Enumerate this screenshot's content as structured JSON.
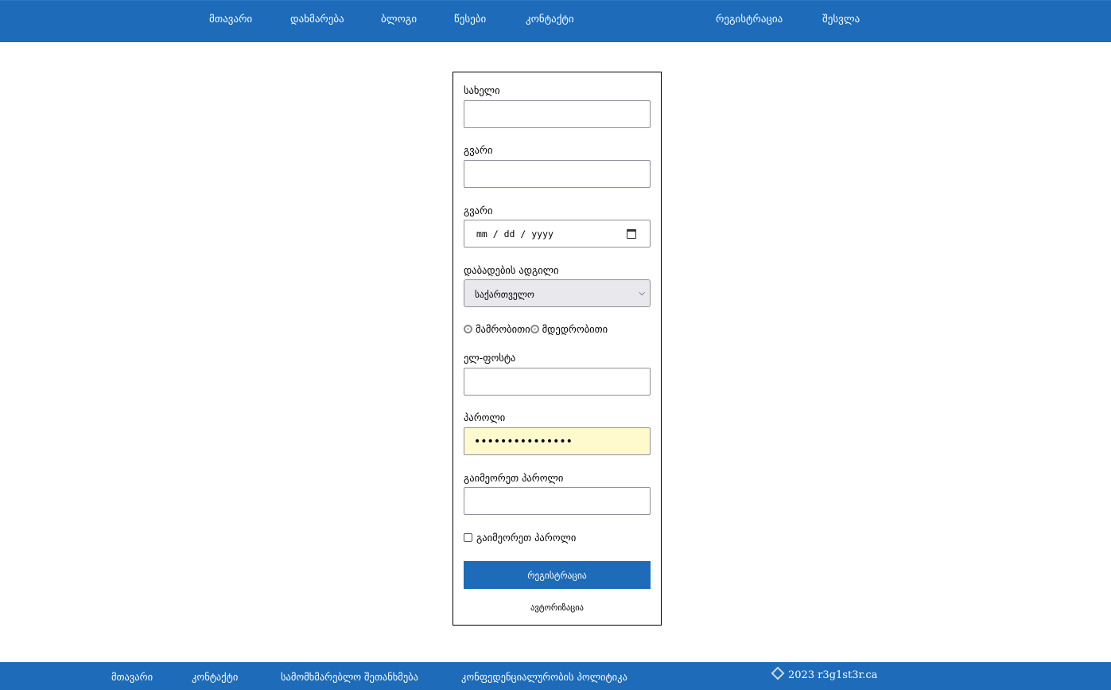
{
  "nav": {
    "left": [
      "მთავარი",
      "დახმარება",
      "ბლოგი",
      "წესები",
      "კონტაქტი"
    ],
    "right": [
      "რეგისტრაცია",
      "შესვლა"
    ]
  },
  "form": {
    "first_name_label": "სახელი",
    "first_name_value": "",
    "last_name_label": "გვარი",
    "last_name_value": "",
    "birthdate_label": "გვარი",
    "birthdate_placeholder": "mm / dd / yyyy",
    "birthplace_label": "დაბადების ადგილი",
    "birthplace_selected": "საქართველო",
    "gender_options": [
      "მამრობითი",
      "მდედრობითი"
    ],
    "email_label": "ელ-ფოსტა",
    "email_value": "",
    "password_label": "პაროლი",
    "password_value": "•••••••••••••••",
    "repeat_password_label": "გაიმეორეთ პაროლი",
    "repeat_password_value": "",
    "show_password_label": "გაიმეორეთ პაროლი",
    "show_password_checked": false,
    "submit_label": "რეგისტრაცია",
    "login_link": "ავტორიზაცია"
  },
  "footer": {
    "links": [
      "მთავარი",
      "კონტაქტი",
      "სამომხმარებლო შეთანხმება",
      "კონფედენციალურობის პოლიტიკა"
    ],
    "copyright": "2023 r3g1st3r.ca"
  },
  "colors": {
    "brand_blue": "#1d6bb9",
    "autofill_yellow": "#fffacd"
  },
  "icons": [
    "calendar-icon",
    "chevron-down-icon",
    "logo-icon"
  ]
}
